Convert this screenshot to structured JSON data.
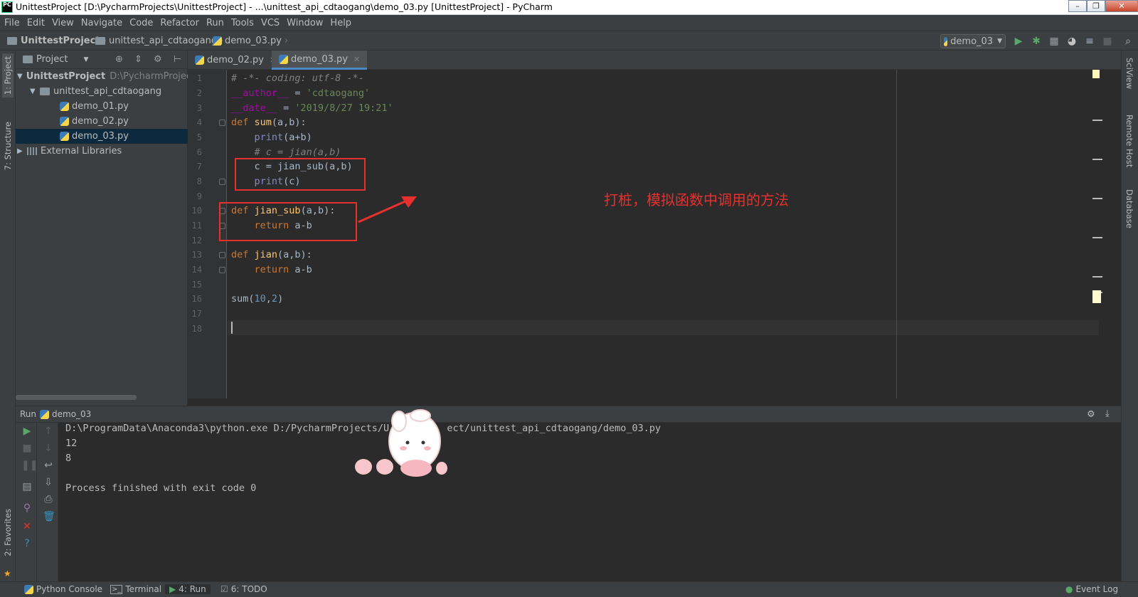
{
  "window": {
    "title": "UnittestProject [D:\\PycharmProjects\\UnittestProject] - ...\\unittest_api_cdtaogang\\demo_03.py [UnittestProject] - PyCharm",
    "app_icon": "PC"
  },
  "menu": [
    "File",
    "Edit",
    "View",
    "Navigate",
    "Code",
    "Refactor",
    "Run",
    "Tools",
    "VCS",
    "Window",
    "Help"
  ],
  "breadcrumb": {
    "project": "UnittestProject",
    "folder": "unittest_api_cdtaogang",
    "file": "demo_03.py"
  },
  "run_config": "demo_03",
  "left_strip": {
    "project_tab": "1: Project",
    "structure_tab": "7: Structure",
    "favorites_tab": "2: Favorites"
  },
  "right_strip": {
    "sciview": "SciView",
    "remote_host": "Remote Host",
    "database": "Database"
  },
  "project_panel": {
    "title": "Project",
    "tree": [
      {
        "label": "UnittestProject",
        "hint": "D:\\PycharmProjec",
        "kind": "root"
      },
      {
        "label": "unittest_api_cdtaogang",
        "kind": "folder"
      },
      {
        "label": "demo_01.py",
        "kind": "file"
      },
      {
        "label": "demo_02.py",
        "kind": "file"
      },
      {
        "label": "demo_03.py",
        "kind": "file",
        "selected": true
      },
      {
        "label": "External Libraries",
        "kind": "lib"
      }
    ]
  },
  "editor_tabs": [
    {
      "label": "demo_02.py",
      "active": false
    },
    {
      "label": "demo_03.py",
      "active": true
    }
  ],
  "code": {
    "line_numbers": [
      "1",
      "2",
      "3",
      "4",
      "5",
      "6",
      "7",
      "8",
      "9",
      "10",
      "11",
      "12",
      "13",
      "14",
      "15",
      "16",
      "17",
      "18"
    ],
    "l1": "# -*- coding: utf-8 -*-",
    "l2_name": "__author__",
    "l2_eq": " = ",
    "l2_val": "'cdtaogang'",
    "l3_name": "__date__",
    "l3_eq": " = ",
    "l3_val": "'2019/8/27 19:21'",
    "def": "def",
    "l4_fn": "sum",
    "l4_rest": "(a,b):",
    "print": "print",
    "l5_rest": "(a+b)",
    "l6": "# c = jian(a,b)",
    "l7": "c = jian_sub(a,b)",
    "l8_rest": "(c)",
    "l10_fn": "jian_sub",
    "l10_rest": "(a,b):",
    "return": "return",
    "l11_rest": " a-b",
    "l13_fn": "jian",
    "l13_rest": "(a,b):",
    "l14_rest": " a-b",
    "l16_a": "sum(",
    "l16_n1": "10",
    "l16_c": ",",
    "l16_n2": "2",
    "l16_b": ")"
  },
  "annotation": "打桩，模拟函数中调用的方法",
  "run_panel": {
    "label": "Run",
    "config": "demo_03",
    "console": [
      "D:\\ProgramData\\Anaconda3\\python.exe D:/PycharmProjects/U          ect/unittest_api_cdtaogang/demo_03.py",
      "12",
      "8",
      "",
      "Process finished with exit code 0"
    ]
  },
  "status_bar": {
    "python_console": "Python Console",
    "terminal": "Terminal",
    "run": "4: Run",
    "todo": "6: TODO",
    "event_log": "Event Log"
  },
  "colors": {
    "keyword": "#cc7832",
    "function": "#ffc66d",
    "string": "#6a8759",
    "number": "#6897bb",
    "annotation_red": "#e8302f",
    "selection": "#0d293e"
  }
}
